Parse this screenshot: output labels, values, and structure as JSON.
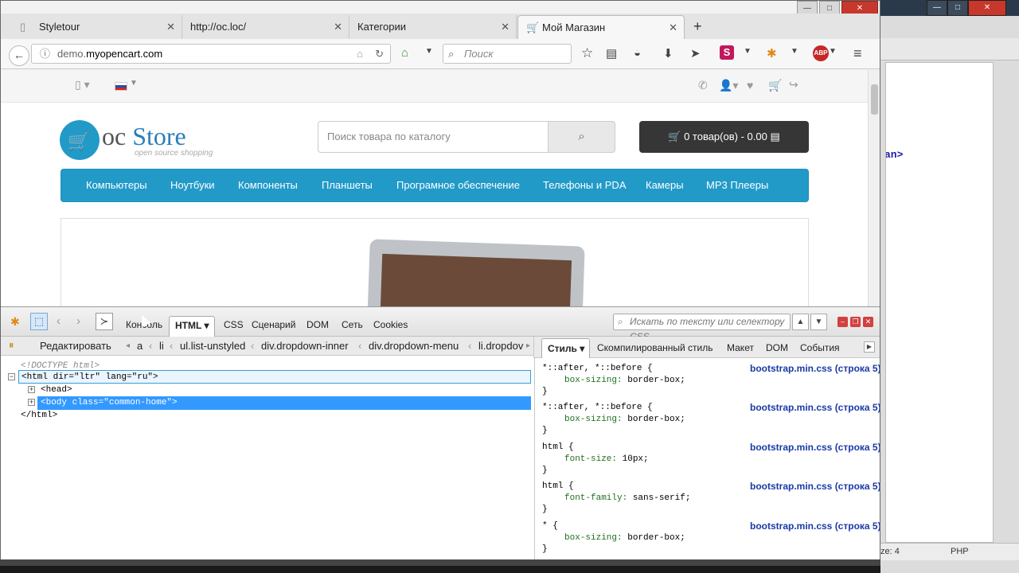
{
  "browser": {
    "tabs": [
      {
        "title": "Styletour"
      },
      {
        "title": "http://oc.loc/"
      },
      {
        "title": "Категории"
      },
      {
        "title": "Мой Магазин"
      }
    ],
    "new_tab": "+",
    "address": {
      "prefix": "demo.",
      "domain": "myopencart.com"
    },
    "search_placeholder": "Поиск"
  },
  "store": {
    "logo_main": "oc",
    "logo_store": "Store",
    "logo_tag": "open source shopping",
    "search_placeholder": "Поиск товара по каталогу",
    "cart_label": "0 товар(ов) - 0.00",
    "menu": [
      "Компьютеры",
      "Ноутбуки",
      "Компоненты",
      "Планшеты",
      "Програмное обеспечение",
      "Телефоны и PDA",
      "Камеры",
      "MP3 Плееры"
    ]
  },
  "firebug": {
    "tabs": [
      "Консоль",
      "HTML",
      "CSS",
      "Сценарий",
      "DOM",
      "Сеть",
      "Cookies"
    ],
    "active_tab": "HTML",
    "search_placeholder": "Искать по тексту или селектору CSS",
    "edit_label": "Редактировать",
    "breadcrumbs": [
      "a",
      "li",
      "ul.list-unstyled",
      "div.dropdown-inner",
      "div.dropdown-menu",
      "li.dropdov"
    ],
    "side_tabs": [
      "Стиль",
      "Скомпилированный стиль",
      "Макет",
      "DOM",
      "События"
    ],
    "tree": {
      "doctype": "<!DOCTYPE html>",
      "html_open": "<html dir=\"ltr\" lang=\"ru\">",
      "head": "<head>",
      "body": "<body class=\"common-home\">",
      "html_close": "</html>"
    },
    "css_rules": [
      {
        "selector": "*::after, *::before {",
        "prop": "box-sizing",
        "value": "border-box;",
        "source": "bootstrap.min.css (строка 5)"
      },
      {
        "selector": "*::after, *::before {",
        "prop": "box-sizing",
        "value": "border-box;",
        "source": "bootstrap.min.css (строка 5)"
      },
      {
        "selector": "html {",
        "prop": "font-size",
        "value": "10px;",
        "source": "bootstrap.min.css (строка 5)"
      },
      {
        "selector": "html {",
        "prop": "font-family",
        "value": "sans-serif;",
        "source": "bootstrap.min.css (строка 5)"
      },
      {
        "selector": "* {",
        "prop": "box-sizing",
        "value": "border-box;",
        "source": "bootstrap.min.css (строка 5)"
      }
    ]
  },
  "background_app": {
    "code_fragment": "an>",
    "status_left": "ze: 4",
    "status_right": "PHP"
  }
}
